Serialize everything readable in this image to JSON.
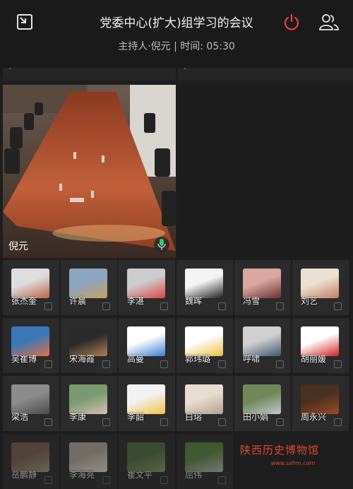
{
  "header": {
    "title": "党委中心(扩大)组学习的会议",
    "subtitle": "主持人·倪元 | 时间: 05:30",
    "exit_icon": "minimize-window-icon",
    "power_icon": "power-icon",
    "members_icon": "members-icon"
  },
  "main": {
    "host_label": "倪元",
    "mic_icon": "microphone-icon"
  },
  "participants": [
    {
      "name": "张杰奎"
    },
    {
      "name": "许晨"
    },
    {
      "name": "李湛"
    },
    {
      "name": "魏晖"
    },
    {
      "name": "冯雪"
    },
    {
      "name": "刘艺"
    },
    {
      "name": "吴崔博"
    },
    {
      "name": "宋海霞"
    },
    {
      "name": "高曼"
    },
    {
      "name": "郭玮璐"
    },
    {
      "name": "呼啸"
    },
    {
      "name": "胡丽媛"
    },
    {
      "name": "梁浩"
    },
    {
      "name": "李康"
    },
    {
      "name": "李韶"
    },
    {
      "name": "白瑢"
    },
    {
      "name": "田小娟"
    },
    {
      "name": "周永兴"
    },
    {
      "name": "岳鹏静"
    },
    {
      "name": "李海亮"
    },
    {
      "name": "崔文平"
    },
    {
      "name": "屈伟"
    }
  ],
  "watermark": {
    "text": "陕西历史博物馆",
    "url": "www.sxhm.com"
  },
  "colors": {
    "accent_red": "#e8453c",
    "background": "#1e1e1e",
    "tile": "#2b2b2b"
  }
}
